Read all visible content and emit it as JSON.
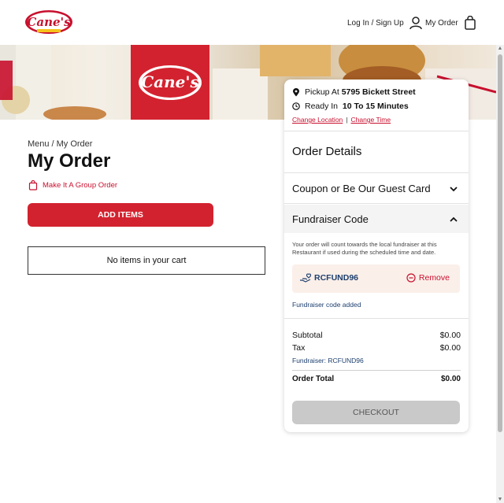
{
  "header": {
    "login_label": "Log In / Sign Up",
    "my_order_label": "My Order",
    "logo_alt": "Raising Cane's Chicken Fingers"
  },
  "breadcrumb": {
    "menu": "Menu",
    "separator": "/",
    "current": "My Order"
  },
  "page_title": "My Order",
  "group_order_label": "Make It A Group Order",
  "add_items_label": "ADD ITEMS",
  "empty_cart_label": "No items in your cart",
  "pickup": {
    "pickup_prefix": "Pickup At",
    "pickup_location": "5795 Bickett Street",
    "ready_prefix": "Ready In",
    "ready_time": "10 To 15 Minutes",
    "change_location": "Change Location",
    "separator": "|",
    "change_time": "Change Time"
  },
  "order_details_title": "Order Details",
  "coupon_title": "Coupon or Be Our Guest Card",
  "fundraiser": {
    "title": "Fundraiser Code",
    "note": "Your order will count towards the local fundraiser at this Restaurant if used during the scheduled time and date.",
    "code": "RCFUND96",
    "remove_label": "Remove",
    "added_label": "Fundraiser code added"
  },
  "totals": {
    "subtotal_label": "Subtotal",
    "subtotal_value": "$0.00",
    "tax_label": "Tax",
    "tax_value": "$0.00",
    "fundraiser_line": "Fundraiser: RCFUND96",
    "total_label": "Order Total",
    "total_value": "$0.00"
  },
  "checkout_label": "CHECKOUT",
  "colors": {
    "brand_red": "#d3222f",
    "link_blue": "#1d3f6e",
    "chip_bg": "#fbefe9"
  }
}
